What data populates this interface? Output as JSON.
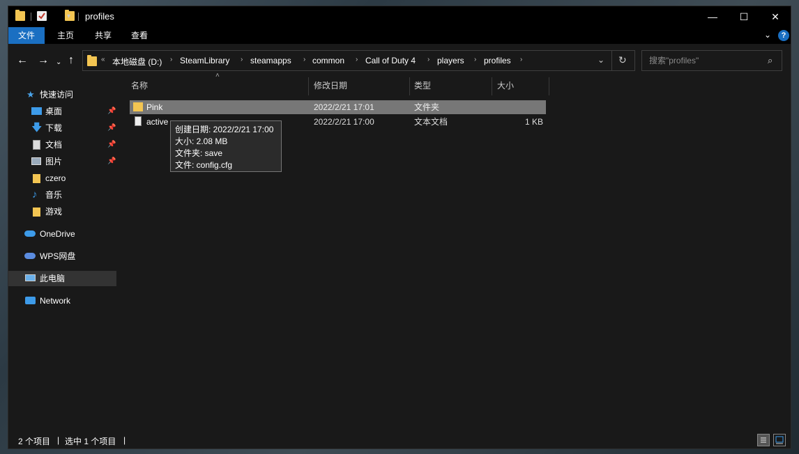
{
  "window": {
    "title": "profiles"
  },
  "ribbon": {
    "tabs": [
      "文件",
      "主页",
      "共享",
      "查看"
    ]
  },
  "address": {
    "overflow": "«",
    "crumbs": [
      "本地磁盘 (D:)",
      "SteamLibrary",
      "steamapps",
      "common",
      "Call of Duty 4",
      "players",
      "profiles"
    ]
  },
  "search": {
    "placeholder": "搜索\"profiles\""
  },
  "sidebar": {
    "items": [
      {
        "label": "快速访问",
        "icon": "star-icon"
      },
      {
        "label": "桌面",
        "icon": "desktop-icon",
        "pinned": true
      },
      {
        "label": "下载",
        "icon": "download-icon",
        "pinned": true
      },
      {
        "label": "文档",
        "icon": "document-icon",
        "pinned": true
      },
      {
        "label": "图片",
        "icon": "pictures-icon",
        "pinned": true
      },
      {
        "label": "czero",
        "icon": "folder-icon"
      },
      {
        "label": "音乐",
        "icon": "music-icon"
      },
      {
        "label": "游戏",
        "icon": "folder-icon"
      },
      {
        "label": "OneDrive",
        "icon": "cloud-icon"
      },
      {
        "label": "WPS网盘",
        "icon": "cloud-icon"
      },
      {
        "label": "此电脑",
        "icon": "computer-icon",
        "selected": true
      },
      {
        "label": "Network",
        "icon": "network-icon"
      }
    ]
  },
  "columns": {
    "name": "名称",
    "modified": "修改日期",
    "type": "类型",
    "size": "大小"
  },
  "files": [
    {
      "name": "Pink",
      "modified": "2022/2/21 17:01",
      "type": "文件夹",
      "size": "",
      "icon": "folder-icon",
      "selected": true
    },
    {
      "name": "active",
      "modified": "2022/2/21 17:00",
      "type": "文本文档",
      "size": "1 KB",
      "icon": "text-file-icon"
    }
  ],
  "tooltip": {
    "created": "创建日期: 2022/2/21 17:00",
    "size": "大小: 2.08 MB",
    "folders": "文件夹: save",
    "files": "文件: config.cfg"
  },
  "status": {
    "count": "2 个项目",
    "selected": "选中 1 个项目",
    "sep": "|"
  },
  "colors": {
    "accent": "#1a6fc2",
    "folder": "#f3c552",
    "selection": "#777777"
  }
}
